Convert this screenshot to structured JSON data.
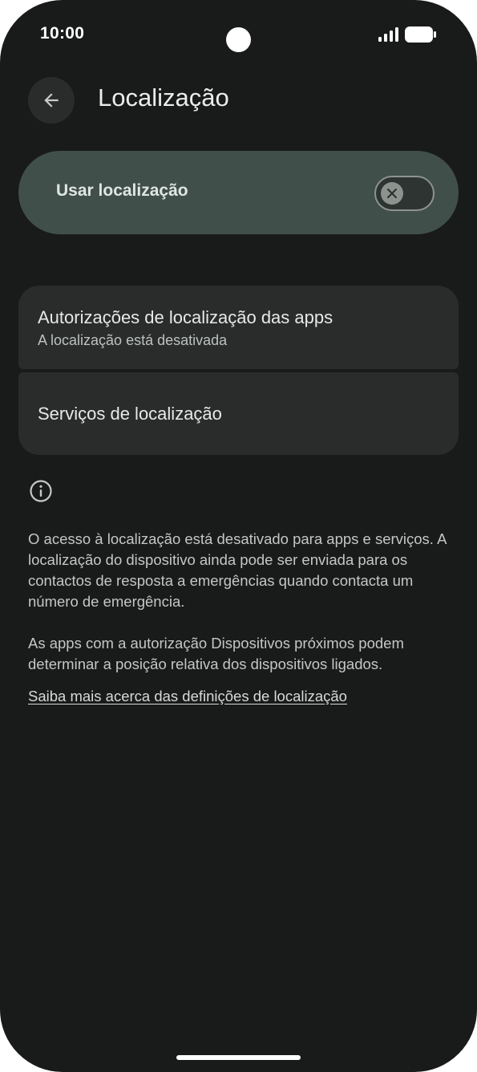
{
  "status_bar": {
    "time": "10:00"
  },
  "app_bar": {
    "title": "Localização",
    "back_icon": "arrow-back-icon"
  },
  "master_switch": {
    "label": "Usar localização",
    "state": "off",
    "thumb_icon": "close-icon"
  },
  "settings": {
    "items": [
      {
        "title": "Autorizações de localização das apps",
        "subtitle": "A localização está desativada"
      },
      {
        "title": "Serviços de localização"
      }
    ]
  },
  "footer": {
    "info_icon": "info-icon",
    "paragraph_1": "O acesso à localização está desativado para apps e serviços. A localização do dispositivo ainda pode ser enviada para os contactos de resposta a emergências quando contacta um número de emergência.",
    "paragraph_2": "As apps com a autorização Dispositivos próximos podem determinar a posição relativa dos dispositivos ligados.",
    "learn_more": "Saiba mais acerca das definições de localização"
  },
  "colors": {
    "background": "#191b1a",
    "switch_container": "#414f4a",
    "card": "#2a2c2b"
  }
}
